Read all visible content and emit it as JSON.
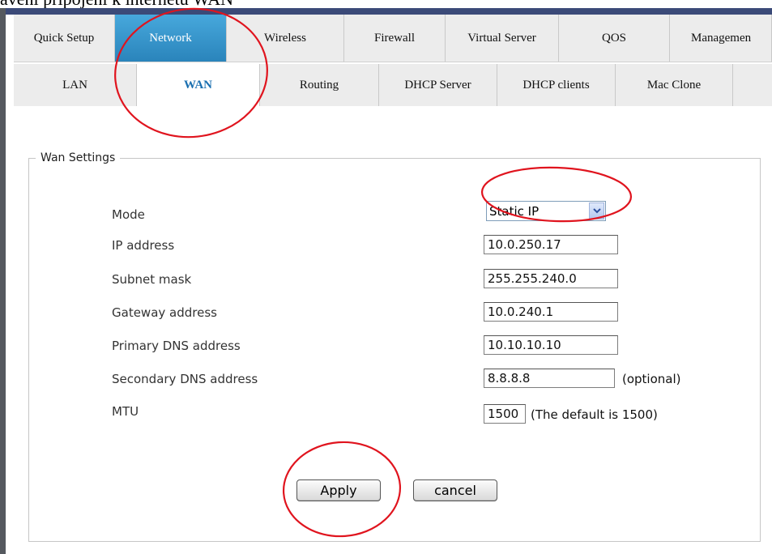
{
  "caption": "avení připojení k internetu WAN",
  "main_tabs": [
    {
      "label": "Quick Setup",
      "active": false
    },
    {
      "label": "Network",
      "active": true
    },
    {
      "label": "Wireless",
      "active": false
    },
    {
      "label": "Firewall",
      "active": false
    },
    {
      "label": "Virtual Server",
      "active": false
    },
    {
      "label": "QOS",
      "active": false
    },
    {
      "label": "Managemen",
      "active": false
    }
  ],
  "sub_tabs": [
    {
      "label": "LAN",
      "active": false
    },
    {
      "label": "WAN",
      "active": true
    },
    {
      "label": "Routing",
      "active": false
    },
    {
      "label": "DHCP Server",
      "active": false
    },
    {
      "label": "DHCP clients",
      "active": false
    },
    {
      "label": "Mac Clone",
      "active": false
    }
  ],
  "wan": {
    "legend": "Wan Settings",
    "mode_label": "Mode",
    "mode_value": "Static IP",
    "ip_label": "IP address",
    "ip_value": "10.0.250.17",
    "subnet_label": "Subnet mask",
    "subnet_value": "255.255.240.0",
    "gateway_label": "Gateway address",
    "gateway_value": "10.0.240.1",
    "dns1_label": "Primary DNS address",
    "dns1_value": "10.10.10.10",
    "dns2_label": "Secondary DNS address",
    "dns2_value": "8.8.8.8",
    "dns2_note": "(optional)",
    "mtu_label": "MTU",
    "mtu_value": "1500",
    "mtu_note": "(The default is 1500)"
  },
  "buttons": {
    "apply": "Apply",
    "cancel": "cancel"
  },
  "colors": {
    "accent": "#2e8fc4",
    "annotation": "#e0141e",
    "header_bar": "#3b4a78"
  }
}
